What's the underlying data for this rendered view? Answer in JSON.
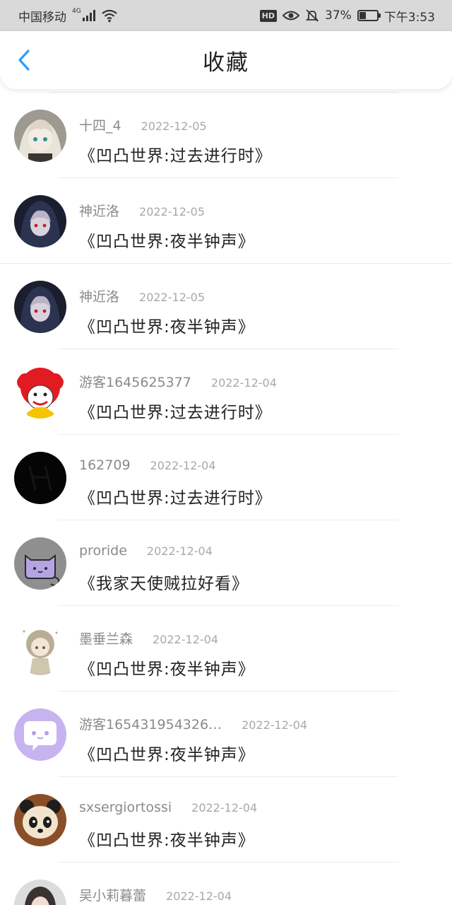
{
  "status_bar": {
    "carrier": "中国移动",
    "network": "4G",
    "hd": "HD",
    "battery": "37%",
    "battery_level": 0.37,
    "time": "下午3:53"
  },
  "header": {
    "title": "收藏"
  },
  "colors": {
    "accent": "#2b9cff",
    "status_bar_bg": "#d9d9d9",
    "text_primary": "#222222",
    "text_secondary": "#8a8a8a",
    "divider": "#ececec"
  },
  "favorites": [
    {
      "username": "十四_4",
      "date": "2022-12-05",
      "title": "《凹凸世界:过去进行时》",
      "avatar_icon": "anime-girl-avatar"
    },
    {
      "username": "神近洛",
      "date": "2022-12-05",
      "title": "《凹凸世界:夜半钟声》",
      "avatar_icon": "hooded-character-avatar"
    },
    {
      "username": "神近洛",
      "date": "2022-12-05",
      "title": "《凹凸世界:夜半钟声》",
      "avatar_icon": "hooded-character-avatar"
    },
    {
      "username": "游客1645625377",
      "date": "2022-12-04",
      "title": "《凹凸世界:过去进行时》",
      "avatar_icon": "clown-avatar"
    },
    {
      "username": "162709",
      "date": "2022-12-04",
      "title": "《凹凸世界:过去进行时》",
      "avatar_icon": "dark-avatar"
    },
    {
      "username": "proride",
      "date": "2022-12-04",
      "title": "《我家天使贼拉好看》",
      "avatar_icon": "cat-avatar"
    },
    {
      "username": "墨垂兰森",
      "date": "2022-12-04",
      "title": "《凹凸世界:夜半钟声》",
      "avatar_icon": "chibi-girl-avatar"
    },
    {
      "username": "游客165431954326…",
      "date": "2022-12-04",
      "title": "《凹凸世界:夜半钟声》",
      "avatar_icon": "chat-bubble-avatar"
    },
    {
      "username": "sxsergiortossi",
      "date": "2022-12-04",
      "title": "《凹凸世界:夜半钟声》",
      "avatar_icon": "panda-avatar"
    },
    {
      "username": "吴小莉暮蕾",
      "date": "2022-12-04",
      "title": "",
      "avatar_icon": "girl-photo-avatar"
    }
  ]
}
